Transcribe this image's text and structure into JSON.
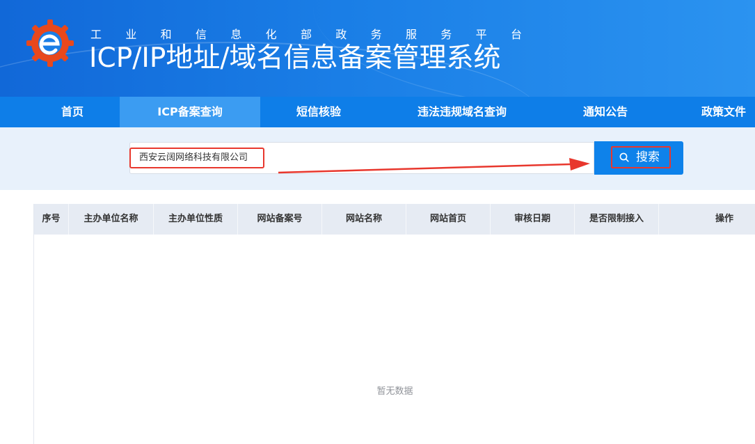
{
  "header": {
    "subtitle_chars": [
      "工",
      "业",
      "和",
      "信",
      "息",
      "化",
      "部",
      "政",
      "务",
      "服",
      "务",
      "平",
      "台"
    ],
    "title": "ICP/IP地址/域名信息备案管理系统"
  },
  "nav": {
    "items": [
      {
        "label": "首页"
      },
      {
        "label": "ICP备案查询"
      },
      {
        "label": "短信核验"
      },
      {
        "label": "违法违规域名查询"
      },
      {
        "label": "通知公告"
      },
      {
        "label": "政策文件"
      }
    ],
    "active_index": 1
  },
  "search": {
    "value": "西安云阔网络科技有限公司",
    "button_label": "搜索"
  },
  "table": {
    "columns": [
      "序号",
      "主办单位名称",
      "主办单位性质",
      "网站备案号",
      "网站名称",
      "网站首页",
      "审核日期",
      "是否限制接入",
      "操作"
    ],
    "empty_text": "暂无数据"
  },
  "colors": {
    "header_blue": "#1a7ee6",
    "nav_blue": "#0e7ee8",
    "highlight_red": "#e8372d",
    "logo_orange": "#e8481c"
  }
}
